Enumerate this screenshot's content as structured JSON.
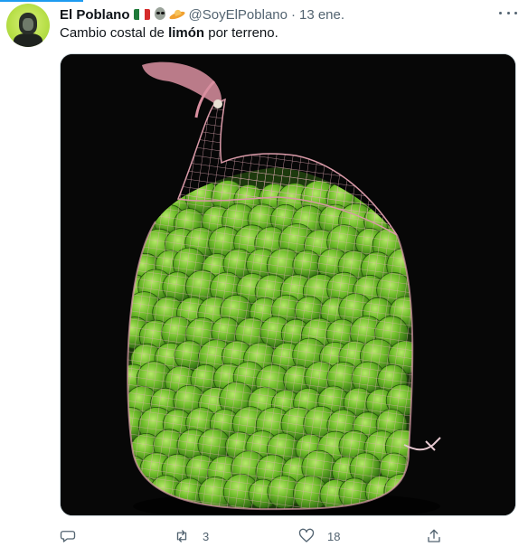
{
  "author": {
    "display_name": "El Poblano",
    "handle": "@SoyElPoblano",
    "separator": "·",
    "date": "13 ene.",
    "avatar_icon": "avatar-photo",
    "emoji": [
      "mexico-flag-icon",
      "alien-icon",
      "flying-saucer-icon"
    ]
  },
  "tweet": {
    "text_before": "Cambio costal de ",
    "text_bold": "limón",
    "text_after": " por terreno."
  },
  "actions": {
    "reply_count": "",
    "retweet_count": "3",
    "like_count": "18",
    "share_count": ""
  },
  "colors": {
    "accent": "#1d9bf0",
    "secondary_text": "#536471",
    "media_background": "#070707",
    "lime": "#5fa81e",
    "net": "#d99aa8"
  }
}
